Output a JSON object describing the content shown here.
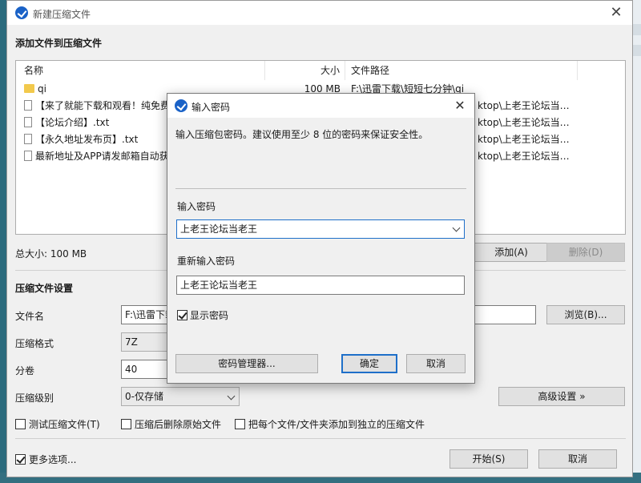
{
  "window": {
    "title": "新建压缩文件"
  },
  "add_section": {
    "title": "添加文件到压缩文件"
  },
  "file_list": {
    "columns": [
      "名称",
      "大小",
      "文件路径"
    ],
    "rows": [
      {
        "icon": "folder-icon",
        "name": "qi",
        "size": "100 MB",
        "path": "F:\\迅雷下载\\短短七分钟\\qi"
      },
      {
        "icon": "file-icon",
        "name": "【来了就能下载和观看！纯免费",
        "size": "",
        "path": "ktop\\上老王论坛当…"
      },
      {
        "icon": "file-icon",
        "name": "【论坛介绍】.txt",
        "size": "",
        "path": "ktop\\上老王论坛当…"
      },
      {
        "icon": "file-icon",
        "name": "【永久地址发布页】.txt",
        "size": "",
        "path": "ktop\\上老王论坛当…"
      },
      {
        "icon": "file-icon",
        "name": "最新地址及APP请发邮箱自动获",
        "size": "",
        "path": "ktop\\上老王论坛当…"
      }
    ]
  },
  "total_size": "总大小: 100 MB",
  "buttons": {
    "add": "添加(A)",
    "delete": "删除(D)",
    "browse": "浏览(B)...",
    "advanced": "高级设置 »",
    "start": "开始(S)",
    "cancel": "取消"
  },
  "settings": {
    "title": "压缩文件设置",
    "filename_label": "文件名",
    "filename_value": "F:\\迅雷下载",
    "format_label": "压缩格式",
    "format_value": "7Z",
    "split_label": "分卷",
    "split_value": "40",
    "level_label": "压缩级别",
    "level_value": "0-仅存储"
  },
  "checkboxes": {
    "test": {
      "label": "测试压缩文件(T)",
      "checked": false
    },
    "delete_original": {
      "label": "压缩后删除原始文件",
      "checked": false
    },
    "separate": {
      "label": "把每个文件/文件夹添加到独立的压缩文件",
      "checked": false
    },
    "more_options": {
      "label": "更多选项...",
      "checked": true
    }
  },
  "dialog": {
    "title": "输入密码",
    "description": "输入压缩包密码。建议使用至少 8 位的密码来保证安全性。",
    "password_label": "输入密码",
    "password_value": "上老王论坛当老王",
    "confirm_label": "重新输入密码",
    "confirm_value": "上老王论坛当老王",
    "show_password": {
      "label": "显示密码",
      "checked": true
    },
    "manager_button": "密码管理器...",
    "ok_button": "确定",
    "cancel_button": "取消"
  },
  "colors": {
    "accent": "#1a62c7",
    "focus_border": "#1e6fc9",
    "desktop": "#2c6b7d"
  }
}
